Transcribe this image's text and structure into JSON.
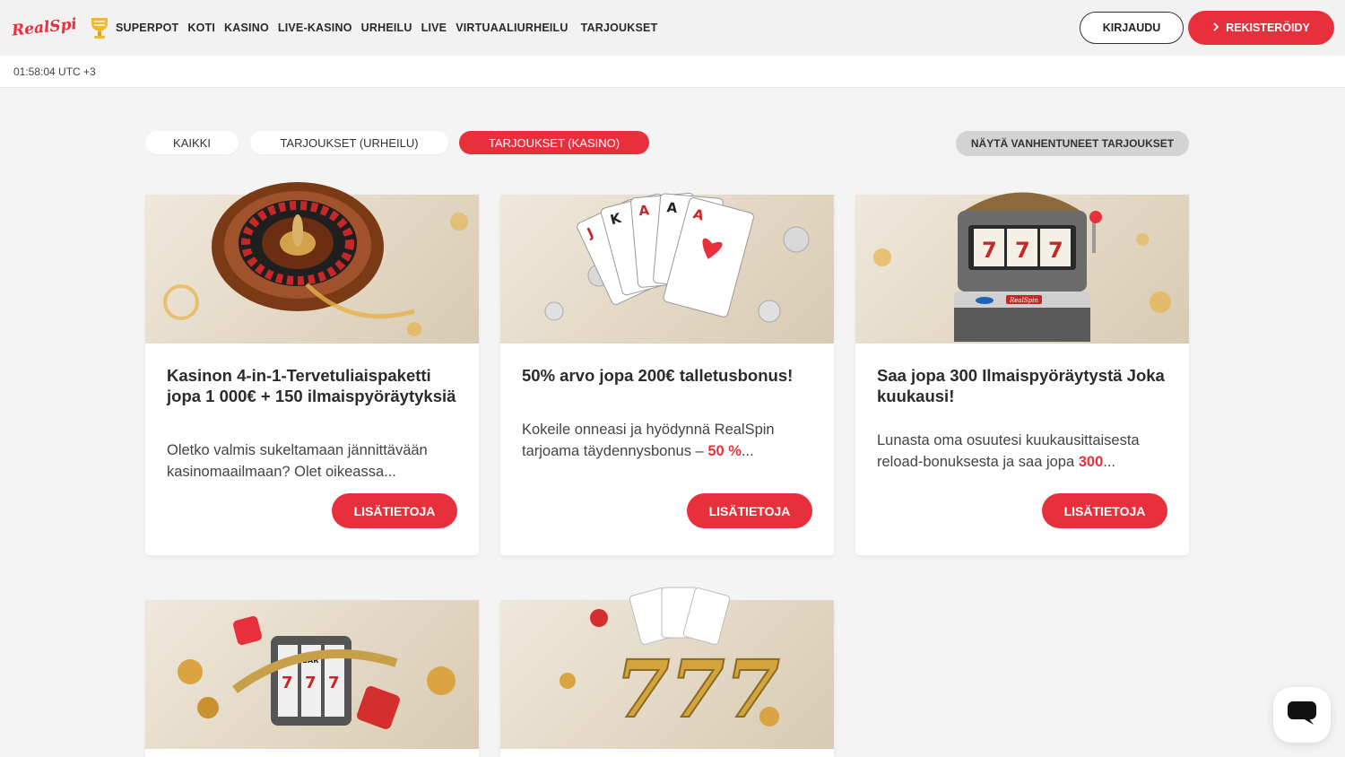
{
  "header": {
    "logo_text": "RealSpin",
    "nav": [
      "SUPERPOT",
      "KOTI",
      "KASINO",
      "LIVE-KASINO",
      "URHEILU",
      "LIVE",
      "VIRTUAALIURHEILU",
      "TARJOUKSET"
    ],
    "login_label": "KIRJAUDU",
    "register_label": "REKISTERÖIDY"
  },
  "time": "01:58:04 UTC +3",
  "filters": {
    "all": "KAIKKI",
    "sports": "TARJOUKSET (URHEILU)",
    "casino": "TARJOUKSET (KASINO)",
    "show_expired": "NÄYTÄ VANHENTUNEET TARJOUKSET"
  },
  "cards": [
    {
      "title": "Kasinon 4-in-1-Tervetuliaispaketti jopa 1 000€ + 150 ilmaispyöräytyksiä",
      "text": "Oletko valmis sukeltamaan jännittävään kasinomaailmaan? Olet oikeassa...",
      "button": "LISÄTIETOJA",
      "image_icon": "roulette-wheel"
    },
    {
      "title": "50% arvo jopa 200€ talletusbonus!",
      "text_before": "Kokeile onneasi ja hyödynnä RealSpin tarjoama täydennysbonus – ",
      "text_highlight": "50 %",
      "text_after": "...",
      "button": "LISÄTIETOJA",
      "image_icon": "playing-cards"
    },
    {
      "title": "Saa jopa 300 Ilmaispyöräytystä Joka kuukausi!",
      "text_before": "Lunasta oma osuutesi kuukausittaisesta reload-bonuksesta ja saa jopa ",
      "text_highlight": "300",
      "text_after": "...",
      "button": "LISÄTIETOJA",
      "image_icon": "slot-machine",
      "slot_text": "RealSpin"
    },
    {
      "image_icon": "slot-reels-dice",
      "reel_text": "BAR"
    },
    {
      "image_icon": "golden-777"
    }
  ],
  "colors": {
    "accent": "#e8303d",
    "background": "#f4f4f4"
  },
  "chat_icon": "chat-icon"
}
